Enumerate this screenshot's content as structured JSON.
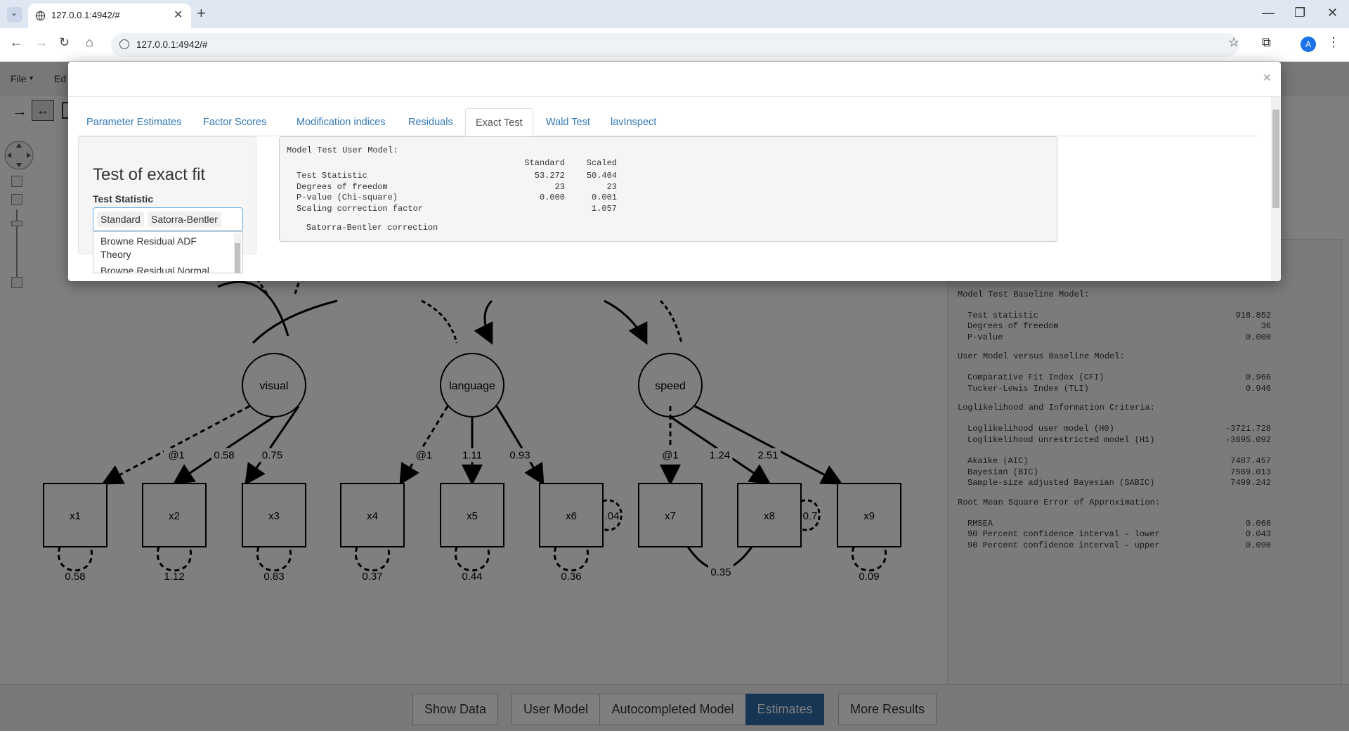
{
  "browser": {
    "tab_title": "127.0.0.1:4942/#",
    "url": "127.0.0.1:4942/#",
    "avatar": "A"
  },
  "app": {
    "menu": [
      "File",
      "Ed"
    ],
    "diagram": {
      "latents": [
        "visual",
        "language",
        "speed"
      ],
      "observed": [
        "x1",
        "x2",
        "x3",
        "x4",
        "x5",
        "x6",
        "x7",
        "x8",
        "x9"
      ],
      "loadings": [
        "@1",
        "0.58",
        "0.75",
        "@1",
        "1.11",
        "0.93",
        "@1",
        "1.24",
        "2.51"
      ],
      "residuals": [
        "0.58",
        "1.12",
        "0.83",
        "0.37",
        "0.44",
        "0.36",
        "0.09"
      ],
      "covariances": [
        ".04",
        "0.35",
        "0.7"
      ]
    },
    "output": [
      {
        "label": "Test statistic",
        "value": "53.272"
      },
      {
        "label": "Degrees of freedom",
        "value": "23"
      },
      {
        "label": "P-value (Chi-square)",
        "value": "0.000"
      },
      {
        "heading": "Model Test Baseline Model:"
      },
      {
        "label": "Test statistic",
        "value": "918.852"
      },
      {
        "label": "Degrees of freedom",
        "value": "36"
      },
      {
        "label": "P-value",
        "value": "0.000"
      },
      {
        "heading": "User Model versus Baseline Model:"
      },
      {
        "label": "Comparative Fit Index (CFI)",
        "value": "0.966"
      },
      {
        "label": "Tucker-Lewis Index (TLI)",
        "value": "0.946"
      },
      {
        "heading": "Loglikelihood and Information Criteria:"
      },
      {
        "label": "Loglikelihood user model (H0)",
        "value": "-3721.728"
      },
      {
        "label": "Loglikelihood unrestricted model (H1)",
        "value": "-3695.092"
      },
      {
        "label": "Akaike (AIC)",
        "value": "7487.457"
      },
      {
        "label": "Bayesian (BIC)",
        "value": "7569.013"
      },
      {
        "label": "Sample-size adjusted Bayesian (SABIC)",
        "value": "7499.242"
      },
      {
        "heading": "Root Mean Square Error of Approximation:"
      },
      {
        "label": "RMSEA",
        "value": "0.066"
      },
      {
        "label": "90 Percent confidence interval - lower",
        "value": "0.043"
      },
      {
        "label": "90 Percent confidence interval - upper",
        "value": "0.090"
      }
    ],
    "bottom_buttons": [
      "Show Data",
      "User Model",
      "Autocompleted Model",
      "Estimates",
      "More Results"
    ]
  },
  "modal": {
    "close": "×",
    "tabs": [
      "Parameter Estimates",
      "Factor Scores",
      "Modification indices",
      "Residuals",
      "Exact Test",
      "Wald Test",
      "lavInspect"
    ],
    "active_tab": "Exact Test",
    "panel_title": "Test of exact fit",
    "panel_label": "Test Statistic",
    "chips": [
      "Standard",
      "Satorra-Bentler"
    ],
    "dropdown": [
      "Browne Residual ADF Theory",
      "Browne Residual Normal"
    ],
    "verbatim": {
      "title": "Model Test User Model:",
      "col1": "Standard",
      "col2": "Scaled",
      "rows": [
        {
          "label": "Test Statistic",
          "a": "53.272",
          "b": "50.404"
        },
        {
          "label": "Degrees of freedom",
          "a": "23",
          "b": "23"
        },
        {
          "label": "P-value (Chi-square)",
          "a": "0.000",
          "b": "0.001"
        },
        {
          "label": "Scaling correction factor",
          "a": "",
          "b": "1.057"
        }
      ],
      "note": "Satorra-Bentler correction"
    }
  }
}
